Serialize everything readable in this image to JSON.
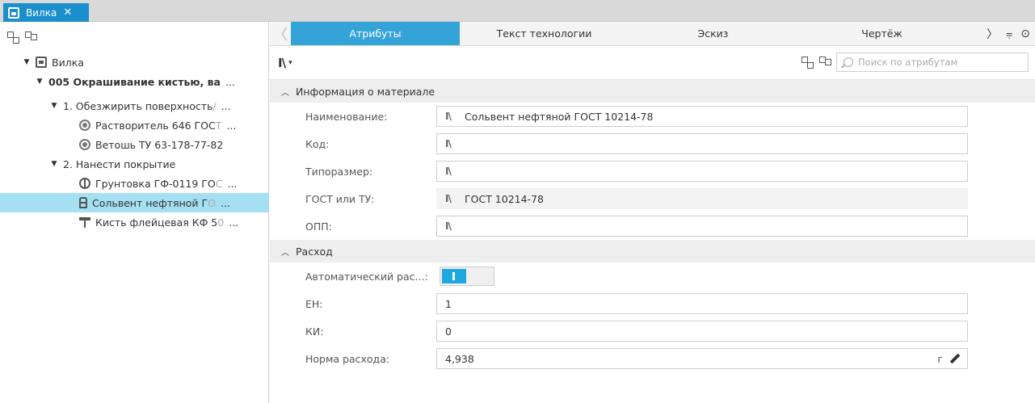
{
  "document_tab": {
    "title": "Вилка",
    "close": "✕",
    "icon": "document-icon",
    "color": "#1a8fcc"
  },
  "tree": [
    {
      "label": "Вилка",
      "faded": "",
      "caret": "▼",
      "icon": "document-icon",
      "bold": false
    },
    {
      "label": "005 Окрашивание кистью, ва",
      "faded": "",
      "caret": "▼",
      "icon": "",
      "bold": true
    },
    {
      "label": "1. Обезжирить поверхность",
      "faded": " /",
      "caret": "▼",
      "icon": "",
      "bold": false
    },
    {
      "label": "Растворитель 646 ГОС",
      "faded": "Т",
      "caret": "",
      "icon": "material-icon",
      "bold": false
    },
    {
      "label": "Ветошь ТУ 63-178-77-82",
      "faded": "",
      "caret": "",
      "icon": "material-icon",
      "bold": false
    },
    {
      "label": "2. Нанести покрытие",
      "faded": "",
      "caret": "▼",
      "icon": "",
      "bold": false
    },
    {
      "label": "Грунтовка ГФ-0119 ГО",
      "faded": "С",
      "caret": "",
      "icon": "primer-icon",
      "bold": false
    },
    {
      "label": "Сольвент нефтяной Г",
      "faded": "О",
      "caret": "",
      "icon": "solvent-icon",
      "bold": false,
      "selected": true
    },
    {
      "label": "Кисть флейцевая КФ 5",
      "faded": "0",
      "caret": "",
      "icon": "brush-icon",
      "bold": false
    }
  ],
  "tree_ellipsis": "...",
  "tabs": [
    "Атрибуты",
    "Текст технологии",
    "Эскиз",
    "Чертёж"
  ],
  "tab_prev": "〈",
  "tab_next": "〉",
  "tab_menu": "⩦",
  "tab_eye": "⊙",
  "toolbar": {
    "lib_icon": "I\\",
    "lib_dropdown": "▾"
  },
  "search": {
    "placeholder": "Поиск по атрибутам"
  },
  "section_material": {
    "title": "Информация о материале",
    "rows": [
      {
        "label": "Наименование:",
        "value": "Сольвент нефтяной ГОСТ 10214-78",
        "readonly": false
      },
      {
        "label": "Код:",
        "value": "",
        "readonly": false
      },
      {
        "label": "Типоразмер:",
        "value": "",
        "readonly": false
      },
      {
        "label": "ГОСТ или ТУ:",
        "value": "ГОСТ 10214-78",
        "readonly": true
      },
      {
        "label": "ОПП:",
        "value": "",
        "readonly": false
      }
    ]
  },
  "section_consumption": {
    "title": "Расход",
    "auto_label": "Автоматический рас...:",
    "auto_on": true,
    "rows": [
      {
        "label": "ЕН:",
        "value": "1"
      },
      {
        "label": "КИ:",
        "value": "0"
      },
      {
        "label": "Норма расхода:",
        "value": "4,938",
        "unit": "г"
      }
    ]
  },
  "colors": {
    "accent": "#34a3d8",
    "selection": "#a5dff2",
    "toggle": "#1ea8e0"
  }
}
